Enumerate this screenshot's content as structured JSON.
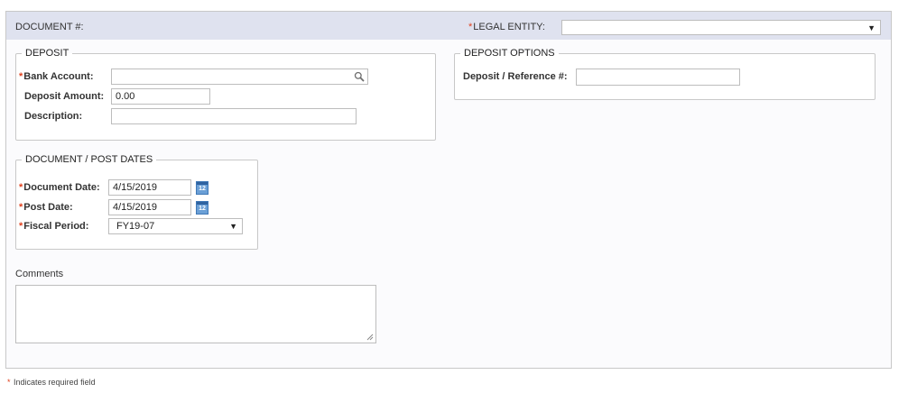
{
  "header": {
    "document_label": "DOCUMENT #:",
    "legal_entity_label": "LEGAL ENTITY:",
    "legal_entity_value": ""
  },
  "deposit": {
    "legend": "DEPOSIT",
    "bank_account_label": "Bank Account:",
    "bank_account_value": "",
    "deposit_amount_label": "Deposit Amount:",
    "deposit_amount_value": "0.00",
    "description_label": "Description:",
    "description_value": ""
  },
  "deposit_options": {
    "legend": "DEPOSIT OPTIONS",
    "reference_label": "Deposit / Reference #:",
    "reference_value": ""
  },
  "dates": {
    "legend": "DOCUMENT / POST DATES",
    "document_date_label": "Document Date:",
    "document_date_value": "4/15/2019",
    "post_date_label": "Post Date:",
    "post_date_value": "4/15/2019",
    "fiscal_period_label": "Fiscal Period:",
    "fiscal_period_value": "FY19-07",
    "calendar_icon_number": "12"
  },
  "comments": {
    "label": "Comments",
    "value": ""
  },
  "footer": {
    "required_marker": "*",
    "required_note": "Indicates required field"
  },
  "icons": {
    "search": "magnifier-icon",
    "calendar": "calendar-icon",
    "dropdown": "triangle-down"
  },
  "colors": {
    "header_bg": "#dfe2ef",
    "required": "#e0401c",
    "calendar": "#6a9fd6"
  }
}
